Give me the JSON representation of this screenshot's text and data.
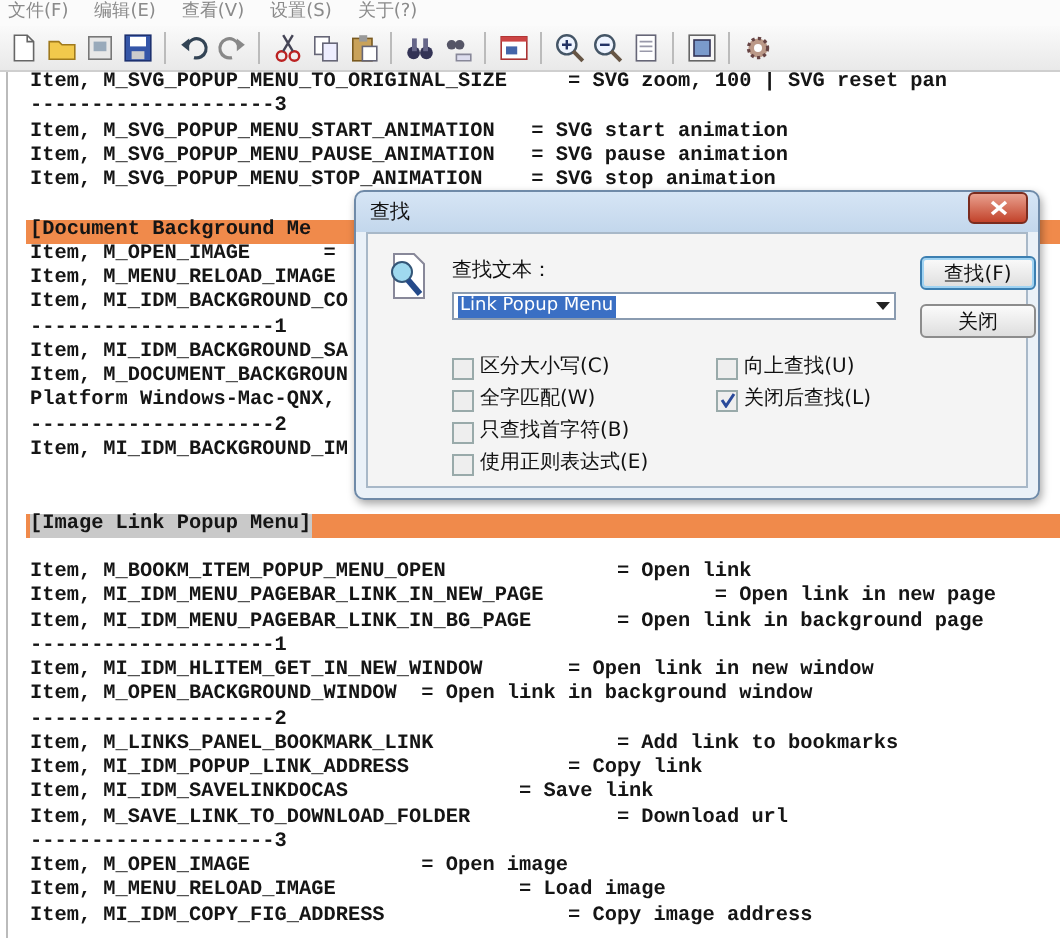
{
  "menu": [
    {
      "label": "文件(F)"
    },
    {
      "label": "编辑(E)"
    },
    {
      "label": "查看(V)"
    },
    {
      "label": "设置(S)"
    },
    {
      "label": "关于(?)"
    }
  ],
  "editor": {
    "lines": [
      {
        "kind": "text",
        "text": "Item, M_SVG_POPUP_MENU_TO_ORIGINAL_SIZE     = SVG zoom, 100 | SVG reset pan"
      },
      {
        "kind": "text",
        "text": "--------------------3"
      },
      {
        "kind": "text",
        "text": "Item, M_SVG_POPUP_MENU_START_ANIMATION   = SVG start animation"
      },
      {
        "kind": "text",
        "text": "Item, M_SVG_POPUP_MENU_PAUSE_ANIMATION   = SVG pause animation"
      },
      {
        "kind": "text",
        "text": "Item, M_SVG_POPUP_MENU_STOP_ANIMATION    = SVG stop animation"
      },
      {
        "kind": "blank"
      },
      {
        "kind": "section",
        "text": "[Document Background Me",
        "selected": false
      },
      {
        "kind": "text",
        "text": "Item, M_OPEN_IMAGE      ="
      },
      {
        "kind": "text",
        "text": "Item, M_MENU_RELOAD_IMAGE"
      },
      {
        "kind": "text",
        "text": "Item, MI_IDM_BACKGROUND_CO"
      },
      {
        "kind": "text",
        "text": "--------------------1"
      },
      {
        "kind": "text",
        "text": "Item, MI_IDM_BACKGROUND_SA"
      },
      {
        "kind": "text",
        "text": "Item, M_DOCUMENT_BACKGROUN"
      },
      {
        "kind": "text",
        "text": "Platform Windows-Mac-QNX,"
      },
      {
        "kind": "text",
        "text": "--------------------2"
      },
      {
        "kind": "text",
        "text": "Item, MI_IDM_BACKGROUND_IM"
      },
      {
        "kind": "blank"
      },
      {
        "kind": "blank"
      },
      {
        "kind": "section",
        "text": "[Image Link Popup Menu]",
        "selected": true
      },
      {
        "kind": "blank"
      },
      {
        "kind": "text",
        "text": "Item, M_BOOKM_ITEM_POPUP_MENU_OPEN              = Open link"
      },
      {
        "kind": "text",
        "text": "Item, MI_IDM_MENU_PAGEBAR_LINK_IN_NEW_PAGE              = Open link in new page"
      },
      {
        "kind": "text",
        "text": "Item, MI_IDM_MENU_PAGEBAR_LINK_IN_BG_PAGE       = Open link in background page"
      },
      {
        "kind": "text",
        "text": "--------------------1"
      },
      {
        "kind": "text",
        "text": "Item, MI_IDM_HLITEM_GET_IN_NEW_WINDOW       = Open link in new window"
      },
      {
        "kind": "text",
        "text": "Item, M_OPEN_BACKGROUND_WINDOW  = Open link in background window"
      },
      {
        "kind": "text",
        "text": "--------------------2"
      },
      {
        "kind": "text",
        "text": "Item, M_LINKS_PANEL_BOOKMARK_LINK               = Add link to bookmarks"
      },
      {
        "kind": "text",
        "text": "Item, MI_IDM_POPUP_LINK_ADDRESS             = Copy link"
      },
      {
        "kind": "text",
        "text": "Item, MI_IDM_SAVELINKDOCAS              = Save link"
      },
      {
        "kind": "text",
        "text": "Item, M_SAVE_LINK_TO_DOWNLOAD_FOLDER            = Download url"
      },
      {
        "kind": "text",
        "text": "--------------------3"
      },
      {
        "kind": "text",
        "text": "Item, M_OPEN_IMAGE              = Open image"
      },
      {
        "kind": "text",
        "text": "Item, M_MENU_RELOAD_IMAGE               = Load image"
      },
      {
        "kind": "text",
        "text": "Item, MI_IDM_COPY_FIG_ADDRESS               = Copy image address"
      }
    ]
  },
  "find_dialog": {
    "title": "查找",
    "label": "查找文本：",
    "search": {
      "value": "Link Popup Menu"
    },
    "buttons": [
      {
        "label": "查找(F)",
        "default": true
      },
      {
        "label": "关闭",
        "default": false
      }
    ],
    "option_columns": [
      [
        {
          "label": "区分大小写(C)",
          "checked": false
        },
        {
          "label": "全字匹配(W)",
          "checked": false
        },
        {
          "label": "只查找首字符(B)",
          "checked": false
        },
        {
          "label": "使用正则表达式(E)",
          "checked": false
        }
      ],
      [
        {
          "label": "向上查找(U)",
          "checked": false
        },
        {
          "label": "关闭后查找(L)",
          "checked": true
        }
      ]
    ]
  }
}
